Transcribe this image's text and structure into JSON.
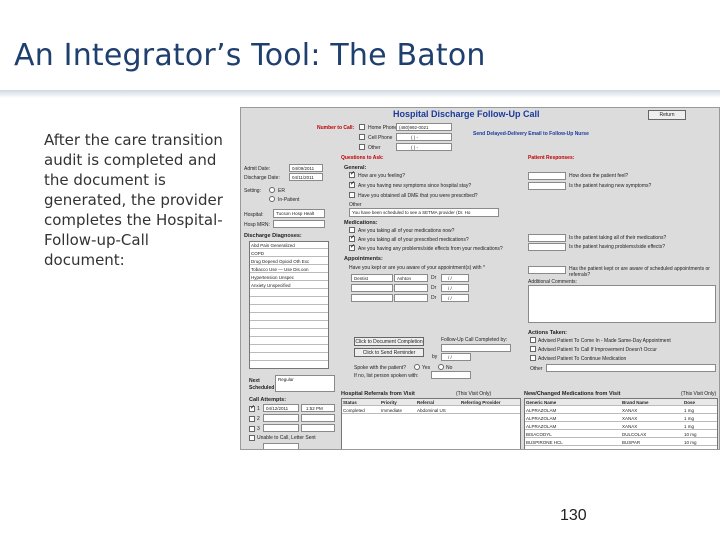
{
  "slide": {
    "title": "An Integrator’s Tool:  The Baton",
    "body": "After the care transition audit is completed and the document is generated, the provider completes the Hospital-Follow-up-Call document:",
    "page_number": "130"
  },
  "form": {
    "title": "Hospital Discharge Follow-Up Call",
    "return_label": "Return",
    "number_to_call_label": "Number to Call:",
    "phone_options": [
      "Home Phone",
      "Cell Phone",
      "Other"
    ],
    "phone_values": [
      "(480)992-0021",
      "(  )  -",
      "(  )  -"
    ],
    "send_email_label": "Send Delayed-Delivery Email to Follow-Up Nurse",
    "questions_label": "Questions to Ask:",
    "patient_responses_label": "Patient Responses:",
    "admit_date_label": "Admit Date:",
    "admit_date": "04/09/2011",
    "discharge_date_label": "Discharge Date:",
    "discharge_date": "04/11/2011",
    "setting_label": "Setting:",
    "setting_options": [
      "ER",
      "In-Patient"
    ],
    "hospital_label": "Hospital:",
    "hospital_value": "Tucson Hosp Healt",
    "hosp_mrn_label": "Hosp MRN:",
    "general_label": "General:",
    "general_items": [
      "How are you feeling?",
      "Are you having new symptoms since hospital stay?",
      "Have you obtained all DME that you were prescribed?"
    ],
    "general_responses": [
      "How does the patient feel?",
      "Is the patient having new symptoms?"
    ],
    "other_label": "Other",
    "other_value": "You have been scheduled to see a SETMA provider (Dr. Ho",
    "discharge_diagnoses_label": "Discharge Diagnoses:",
    "diagnoses": [
      "Abd Pain Generalized",
      "COPD",
      "Drug Depend Opioid Oth Exc",
      "Tobacco Use — Use Dis.oon",
      "Hypertension Unspec",
      "Anxiety Unspecified"
    ],
    "medications_label": "Medications:",
    "medications_items": [
      "Are you taking all of your medications now?",
      "Are you taking all of your prescribed medications?",
      "Are you having any problems/side effects from your medications?"
    ],
    "medications_responses": [
      "Is the patient taking all of their medications?",
      "Is the patient having problems/side effects?"
    ],
    "appointments_label": "Appointments:",
    "appointments_question": "Have you kept or are you aware of your appointment(s) with *",
    "appt_rows": [
      [
        "Dentist",
        "Ashton",
        "Dr",
        "/ /"
      ],
      [
        "",
        "",
        "Dr",
        "/ /"
      ],
      [
        "",
        "",
        "Dr",
        "/ /"
      ]
    ],
    "appt_response": "Has the patient kept or are aware of scheduled appointments or referrals?",
    "additional_comments_label": "Additional Comments:",
    "click_doc_completion": "Click to Document Completion",
    "click_send_reminder": "Click to Send Reminder",
    "followup_completed_by": "Follow-Up Call Completed by:",
    "by_label": "by",
    "spoke_with_label": "Spoke with the patient?",
    "spoke_options": [
      "Yes",
      "No"
    ],
    "if_no_label": "If no, list person spoken with:",
    "actions_label": "Actions Taken:",
    "actions": [
      "Advised Patient To Come In - Made Same-Day Appointment",
      "Advised Patient To Call If Improvement Doesn't Occur",
      "Advised Patient To Continue Medication"
    ],
    "next_label": "Next",
    "scheduled_label": "Scheduled",
    "next_value": "Regular",
    "call_attempts_label": "Call Attempts:",
    "call_attempts": [
      [
        "1",
        "04/12/2011",
        "1:52 PM"
      ],
      [
        "2",
        "",
        ""
      ],
      [
        "3",
        "",
        ""
      ]
    ],
    "unable_label": "Unable to Call, Letter Sent",
    "referrals_label": "Hospital Referrals from Visit",
    "referrals_note": "(This Visit Only)",
    "referral_headers": [
      "Status",
      "Priority",
      "Referral",
      "Referring Provider"
    ],
    "referral_rows": [
      [
        "Completed",
        "Immediate",
        "Abdominal US",
        ""
      ]
    ],
    "new_meds_label": "New/Changed Medications from Visit",
    "new_meds_note": "(This Visit Only)",
    "med_headers": [
      "Generic Name",
      "Brand Name",
      "Dose"
    ],
    "med_rows": [
      [
        "ALPRAZOLAM",
        "XANAX",
        "1 mg"
      ],
      [
        "ALPRAZOLAM",
        "XANAX",
        "1 mg"
      ],
      [
        "ALPRAZOLAM",
        "XANAX",
        "1 mg"
      ],
      [
        "BISACODYL",
        "DULCOLAX",
        "10 mg"
      ],
      [
        "BUSPIRONE HCL",
        "BUSPAR",
        "10 mg"
      ]
    ]
  }
}
